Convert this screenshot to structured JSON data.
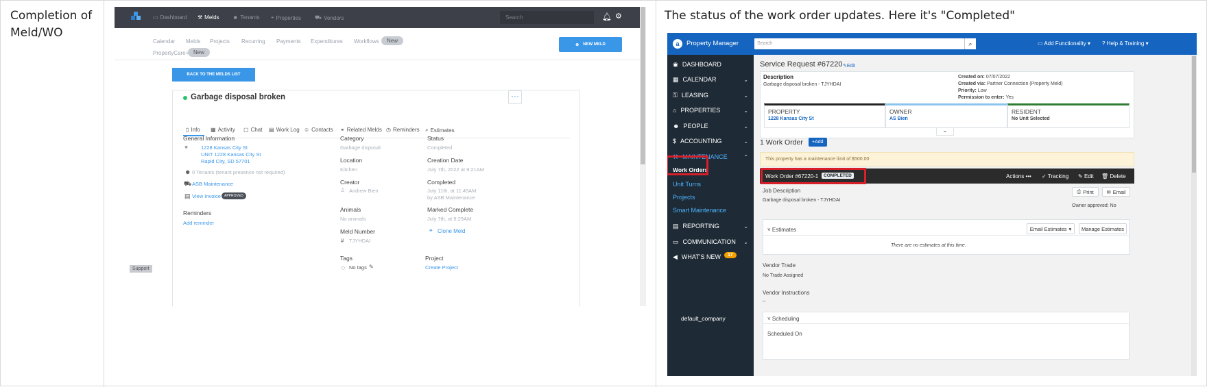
{
  "doc": {
    "left_title": "Completion of Meld/WO",
    "right_title": "The status of the work order updates. Here it's \"Completed\""
  },
  "meld_app": {
    "nav": [
      "Dashboard",
      "Melds",
      "Tenants",
      "Properties",
      "Vendors"
    ],
    "search_placeholder": "Search",
    "subnav": [
      "Calendar",
      "Melds",
      "Projects",
      "Recurring",
      "Payments",
      "Expenditures",
      "Workflows"
    ],
    "subnav_badge": "New",
    "propertycare": "PropertyCare+",
    "propertycare_badge": "New",
    "new_meld": "NEW MELD",
    "back": "BACK TO THE MELDS LIST",
    "meld_title": "Garbage disposal broken",
    "tabs": [
      "Info",
      "Activity",
      "Chat",
      "Work Log",
      "Contacts",
      "Related Melds",
      "Reminders",
      "Estimates"
    ],
    "general_info": "General Information",
    "address": [
      "1228 Kansas City St",
      "UNIT 1228 Kansas City St",
      "Rapid City, SD 57701"
    ],
    "tenants": "0 Tenants (tenant presence not required)",
    "vendor": "ASB Maintenance",
    "invoice": "View Invoice",
    "invoice_badge": "APPROVED",
    "reminders": "Reminders",
    "add_reminder": "Add reminder",
    "category_label": "Category",
    "category": "Garbage disposal",
    "location_label": "Location",
    "location": "Kitchen",
    "creator_label": "Creator",
    "creator": "Andrew Bien",
    "animals_label": "Animals",
    "animals": "No animals",
    "meld_number_label": "Meld Number",
    "meld_number": "TJYHDAI",
    "tags_label": "Tags",
    "tags": "No tags",
    "status_label": "Status",
    "status": "Completed",
    "creation_label": "Creation Date",
    "creation": "July 7th, 2022 at 9:21AM",
    "completed_label": "Completed",
    "completed": "July 11th, at 11:45AM",
    "completed_by": "by ASB Maintenance",
    "marked_label": "Marked Complete",
    "marked": "July 7th, at 9:29AM",
    "clone": "Clone Meld",
    "project_label": "Project",
    "create_project": "Create Project",
    "support": "Support"
  },
  "pm_app": {
    "brand": "Property Manager",
    "search_placeholder": "Search",
    "add_functionality": "Add Functionality",
    "help": "Help & Training",
    "sidebar": [
      "DASHBOARD",
      "CALENDAR",
      "LEASING",
      "PROPERTIES",
      "PEOPLE",
      "ACCOUNTING",
      "MAINTENANCE"
    ],
    "maintenance_sub": [
      "Work Orders",
      "Unit Turns",
      "Projects",
      "Smart Maintenance"
    ],
    "sidebar2": [
      "REPORTING",
      "COMMUNICATION",
      "WHAT'S NEW"
    ],
    "whats_new_badge": "17",
    "company": "default_company",
    "sr_title": "Service Request #67220",
    "edit": "Edit",
    "description_label": "Description",
    "description": "Garbage disposal broken - TJYHDAI",
    "created_on_label": "Created on:",
    "created_on": "07/07/2022",
    "created_via_label": "Created via:",
    "created_via": "Partner Connection (Property Meld)",
    "priority_label": "Priority:",
    "priority": "Low",
    "permission_label": "Permission to enter:",
    "permission": "Yes",
    "property_label": "PROPERTY",
    "property": "1228 Kansas City St",
    "owner_label": "OWNER",
    "owner": "AS Bien",
    "resident_label": "RESIDENT",
    "resident": "No Unit Selected",
    "wo_count": "1 Work Order",
    "add": "Add",
    "limit": "This property has a maintenance limit of $500.00",
    "wo_title": "Work Order #67220-1",
    "wo_status": "COMPLETED",
    "actions": "Actions",
    "tracking": "Tracking",
    "wo_edit": "Edit",
    "delete": "Delete",
    "job_desc_label": "Job Description",
    "job_desc": "Garbage disposal broken - TJYHDAI",
    "print": "Print",
    "email": "Email",
    "owner_approved": "Owner approved: No",
    "estimates": "Estimates",
    "email_estimates": "Email Estimates",
    "manage_estimates": "Manage Estimates",
    "no_estimates": "There are no estimates at this time.",
    "vendor_trade_label": "Vendor Trade",
    "vendor_trade": "No Trade Assigned",
    "vendor_instr_label": "Vendor Instructions",
    "vendor_instr": "--",
    "scheduling": "Scheduling",
    "scheduled_on": "Scheduled On"
  }
}
